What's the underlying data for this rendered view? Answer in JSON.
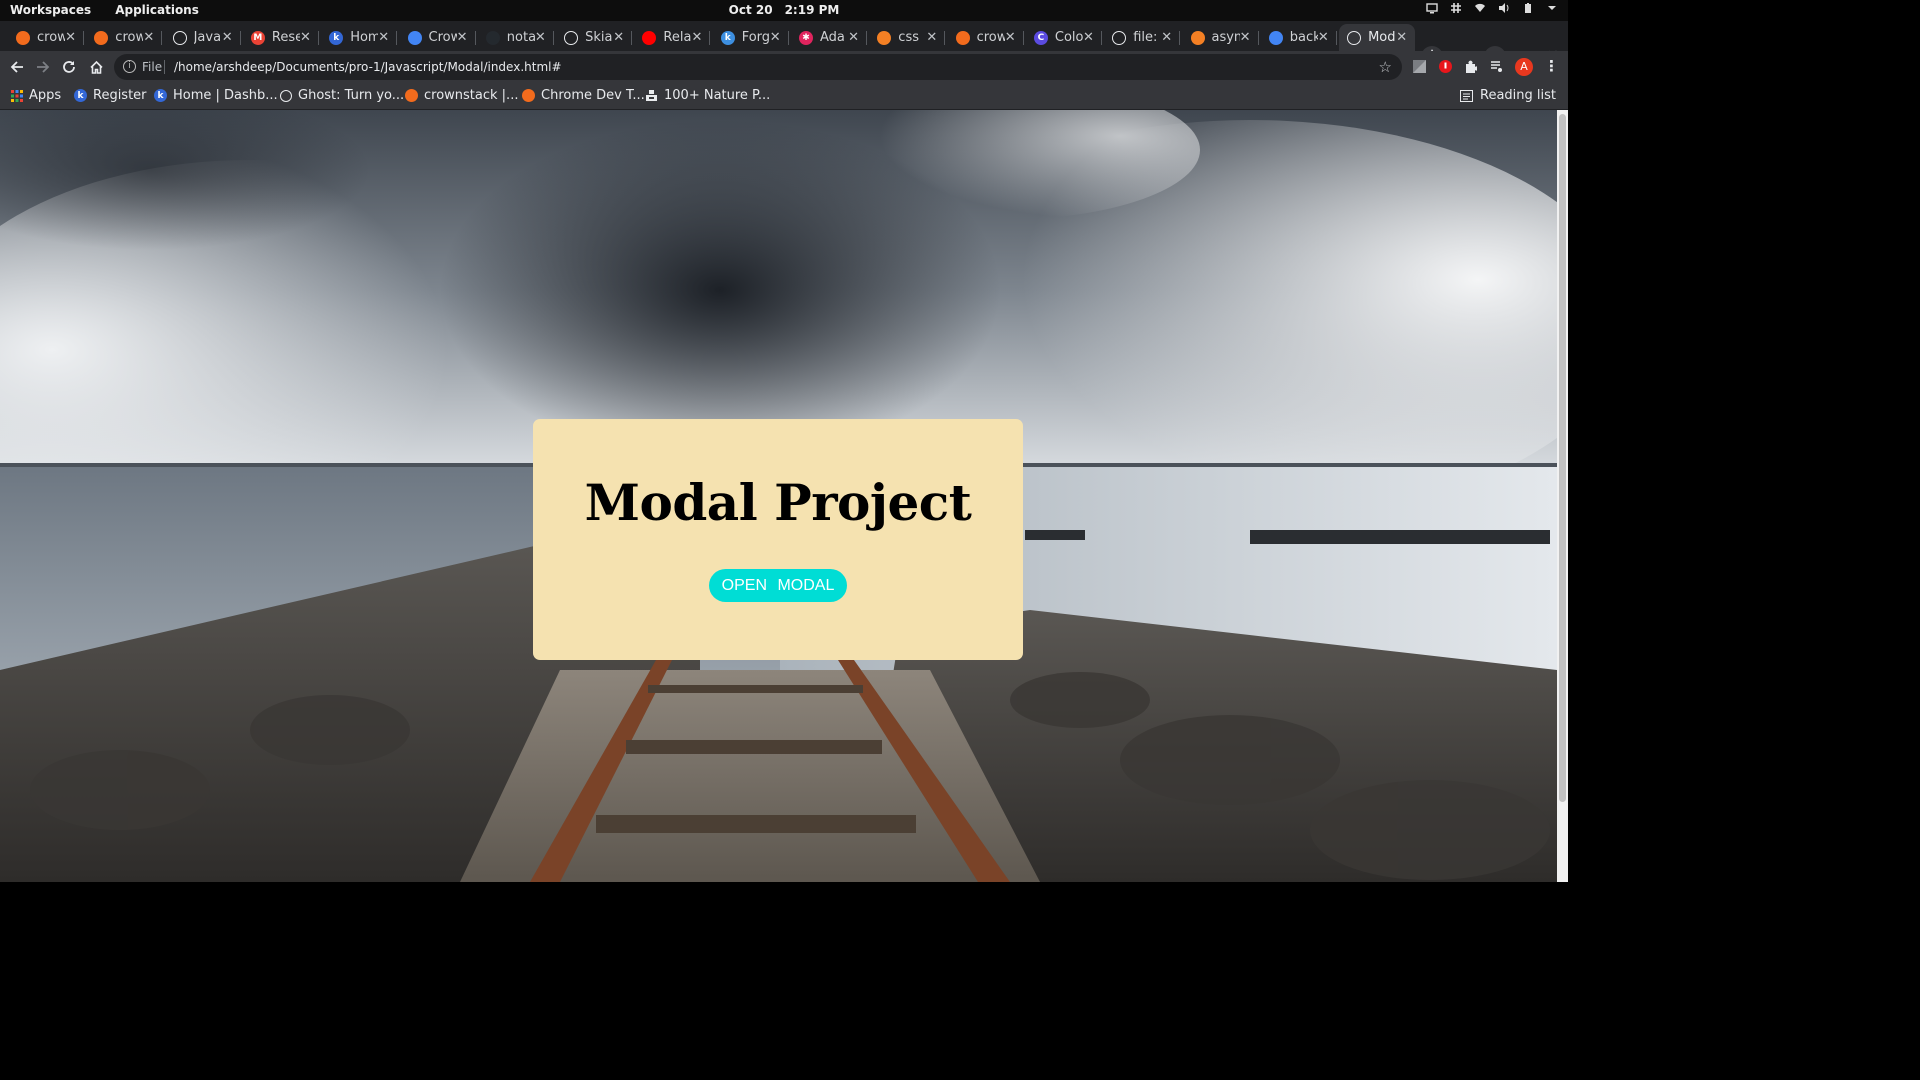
{
  "system_bar": {
    "workspaces": "Workspaces",
    "applications": "Applications",
    "date": "Oct 20",
    "time": "2:19 PM"
  },
  "tabs": [
    {
      "title": "crow",
      "favicon": "crownstack-icon",
      "color": "#f26b1d"
    },
    {
      "title": "crow",
      "favicon": "crownstack-icon",
      "color": "#f26b1d"
    },
    {
      "title": "Java",
      "favicon": "bookmark-icon",
      "color": "#ffffff"
    },
    {
      "title": "Rese",
      "favicon": "gmail-icon",
      "color": "#ea4335"
    },
    {
      "title": "Hom",
      "favicon": "k-icon",
      "color": "#3367d6"
    },
    {
      "title": "Crow",
      "favicon": "calendar-icon",
      "color": "#4285f4"
    },
    {
      "title": "nota",
      "favicon": "github-icon",
      "color": "#24292e"
    },
    {
      "title": "Skia",
      "favicon": "globe-icon",
      "color": "#ffffff"
    },
    {
      "title": "Rela",
      "favicon": "youtube-icon",
      "color": "#ff0000"
    },
    {
      "title": "Forg",
      "favicon": "k-icon",
      "color": "#3d8fe0"
    },
    {
      "title": "Ada",
      "favicon": "asterisk-icon",
      "color": "#e0245e"
    },
    {
      "title": "css",
      "favicon": "stackoverflow-icon",
      "color": "#f48024"
    },
    {
      "title": "crow",
      "favicon": "crownstack-icon",
      "color": "#f26b1d"
    },
    {
      "title": "Colo",
      "favicon": "c-icon",
      "color": "#5b4be0"
    },
    {
      "title": "file:",
      "favicon": "globe-icon",
      "color": "#ffffff"
    },
    {
      "title": "asyn",
      "favicon": "stackoverflow-icon",
      "color": "#f48024"
    },
    {
      "title": "back",
      "favicon": "google-icon",
      "color": "#4285f4"
    },
    {
      "title": "Mod",
      "favicon": "globe-icon",
      "color": "#ffffff",
      "active": true
    }
  ],
  "toolbar": {
    "scheme": "File",
    "url": "/home/arshdeep/Documents/pro-1/Javascript/Modal/index.html#",
    "profile_initial": "A"
  },
  "bookmarks": [
    {
      "label": "Apps",
      "favicon": "apps-grid-icon"
    },
    {
      "label": "Register",
      "favicon": "k-icon"
    },
    {
      "label": "Home | Dashb...",
      "favicon": "k-icon"
    },
    {
      "label": "Ghost: Turn yo...",
      "favicon": "ghost-icon"
    },
    {
      "label": "crownstack |...",
      "favicon": "crownstack-icon"
    },
    {
      "label": "Chrome Dev T...",
      "favicon": "crownstack-icon"
    },
    {
      "label": "100+ Nature P...",
      "favicon": "unsplash-icon"
    }
  ],
  "reading_list": "Reading list",
  "page": {
    "title": "Modal Project",
    "open_button": "OPEN MODAL",
    "card_color": "#f5e2b0",
    "button_color": "#00ddd5"
  }
}
